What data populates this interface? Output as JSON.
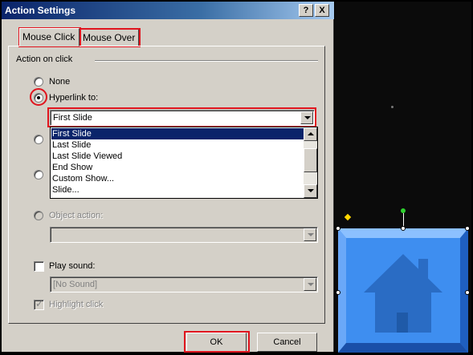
{
  "dialog": {
    "title": "Action Settings",
    "help_label": "?",
    "close_label": "X",
    "tabs": [
      {
        "label": "Mouse Click",
        "selected": true
      },
      {
        "label": "Mouse Over",
        "selected": false
      }
    ],
    "group_label": "Action on click",
    "options": {
      "none": "None",
      "hyperlink": "Hyperlink to:",
      "object_action": "Object action:"
    },
    "hyperlink_value": "First Slide",
    "hyperlink_options": [
      "First Slide",
      "Last Slide",
      "Last Slide Viewed",
      "End Show",
      "Custom Show...",
      "Slide..."
    ],
    "play_sound_label": "Play sound:",
    "sound_value": "[No Sound]",
    "highlight_label": "Highlight click",
    "ok_label": "OK",
    "cancel_label": "Cancel"
  },
  "colors": {
    "highlight_box": "#e0141e",
    "title_bar": "#0a246a",
    "selection": "#0a246a",
    "button_blue": "#3e8ef0",
    "house": "#2a6cc4"
  },
  "icons": {
    "house": "house-icon"
  }
}
